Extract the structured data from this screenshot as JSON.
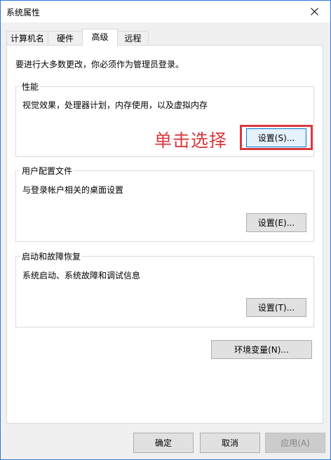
{
  "window": {
    "title": "系统属性"
  },
  "tabs": [
    {
      "label": "计算机名"
    },
    {
      "label": "硬件"
    },
    {
      "label": "高级"
    },
    {
      "label": "远程"
    }
  ],
  "active_tab": "高级",
  "intro": "要进行大多数更改，你必须作为管理员登录。",
  "performance": {
    "label": "性能",
    "description": "视觉效果，处理器计划，内存使用，以及虚拟内存",
    "button": "设置(S)..."
  },
  "user_profiles": {
    "label": "用户配置文件",
    "description": "与登录帐户相关的桌面设置",
    "button": "设置(E)..."
  },
  "startup_recovery": {
    "label": "启动和故障恢复",
    "description": "系统启动、系统故障和调试信息",
    "button": "设置(T)..."
  },
  "env_button": "环境变量(N)...",
  "footer": {
    "ok": "确定",
    "cancel": "取消",
    "apply": "应用(A)"
  },
  "annotation": {
    "text": "单击选择",
    "color": "#d9383c"
  },
  "colors": {
    "accent": "#0078d7",
    "window_border": "#2b79d9",
    "dialog_bg": "#f0f0f0"
  }
}
